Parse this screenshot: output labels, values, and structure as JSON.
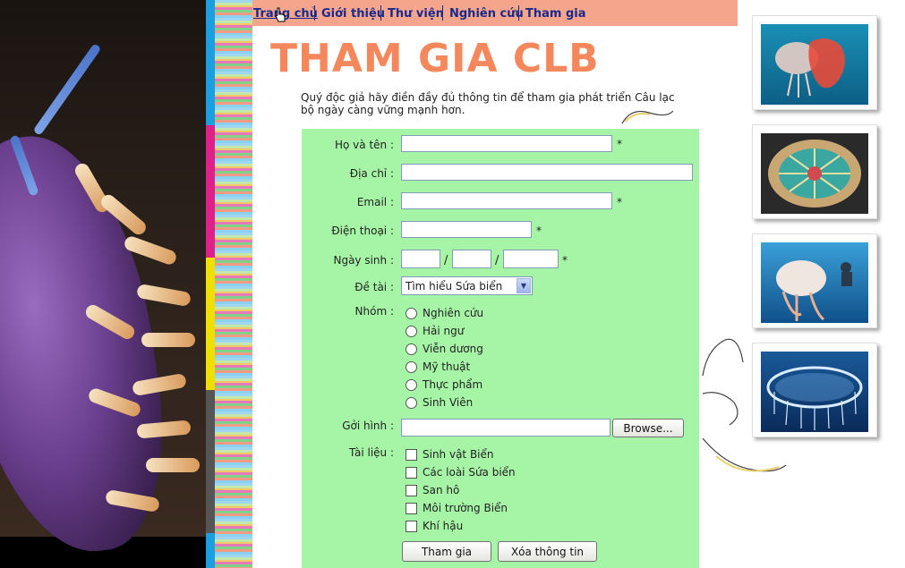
{
  "nav": {
    "items": [
      {
        "label": "Trang chủ"
      },
      {
        "label": "Giới thiệu"
      },
      {
        "label": "Thư viện"
      },
      {
        "label": "Nghiên cứu"
      },
      {
        "label": "Tham gia"
      }
    ]
  },
  "header": {
    "title": "THAM GIA CLB",
    "intro": "Quý độc giả hãy điền đầy đủ thông tin để tham gia phát triển Câu lạc bộ ngày càng vững mạnh hơn."
  },
  "form": {
    "full_name": {
      "label": "Họ và tên :",
      "value": "",
      "required": "*"
    },
    "address": {
      "label": "Địa chỉ :",
      "value": ""
    },
    "email": {
      "label": "Email :",
      "value": "",
      "required": "*"
    },
    "phone": {
      "label": "Điện thoại :",
      "value": "",
      "required": "*"
    },
    "birthdate": {
      "label": "Ngày sinh :",
      "day": "",
      "month": "",
      "year": "",
      "separator": "/",
      "required": "*"
    },
    "topic": {
      "label": "Đề tài :",
      "selected": "Tìm hiểu Sứa biển"
    },
    "group": {
      "label": "Nhóm :",
      "options": [
        "Nghiên cứu",
        "Hải ngư",
        "Viễn dương",
        "Mỹ thuật",
        "Thực phẩm",
        "Sinh Viên"
      ]
    },
    "upload": {
      "label": "Gởi hình :",
      "value": "",
      "browse_label": "Browse..."
    },
    "documents": {
      "label": "Tài liệu :",
      "options": [
        "Sinh vật Biển",
        "Các loài Sứa biển",
        "San hô",
        "Môi trường Biển",
        "Khí hậu"
      ]
    },
    "submit_label": "Tham gia",
    "reset_label": "Xóa thông tin"
  },
  "colors": {
    "nav_bg": "#f6a58d",
    "nav_text": "#1a2a8a",
    "title": "#f4875b",
    "form_bg": "#a6f5a6"
  },
  "photos": [
    {
      "icon": "jellyfish-orange-photo"
    },
    {
      "icon": "jellyfish-disc-photo"
    },
    {
      "icon": "jellyfish-diver-photo"
    },
    {
      "icon": "jellyfish-ring-photo"
    }
  ]
}
